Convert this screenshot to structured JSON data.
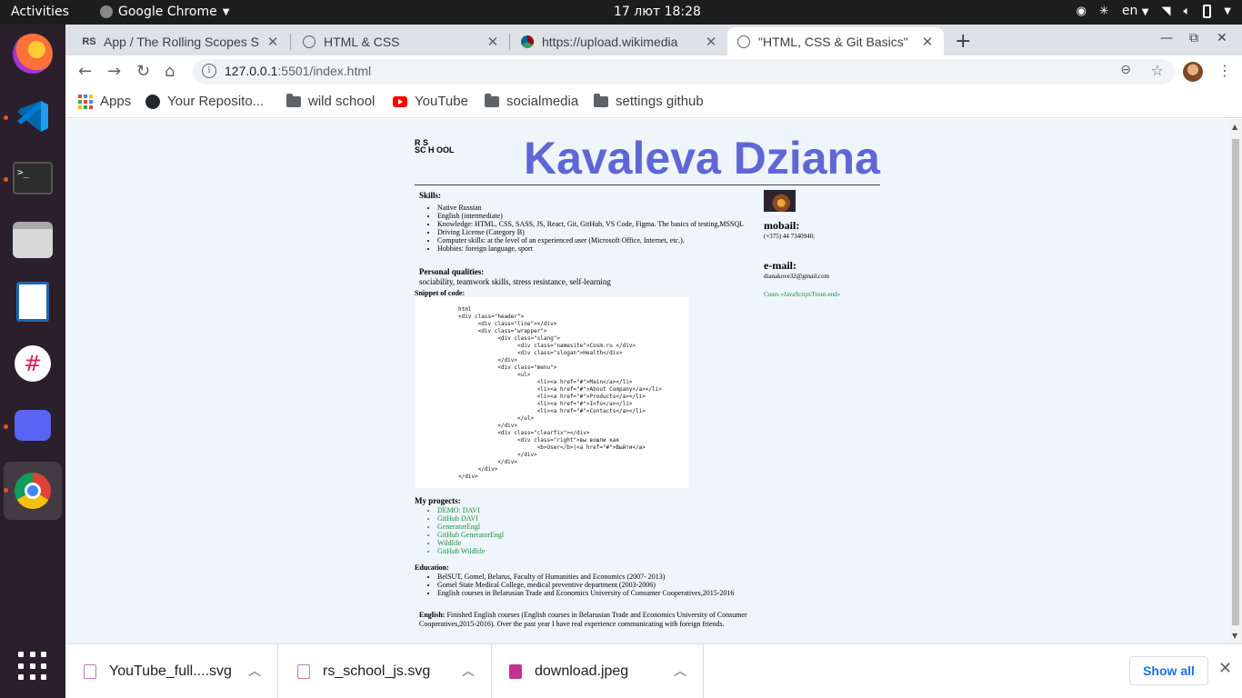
{
  "topbar": {
    "activities": "Activities",
    "app_name": "Google Chrome",
    "clock": "17 лют  18:28",
    "lang": "en"
  },
  "tabs": [
    {
      "favicon": "RS",
      "title": "App / The Rolling Scopes S",
      "active": false
    },
    {
      "favicon": "globe-icon",
      "title": "HTML & CSS",
      "active": false
    },
    {
      "favicon": "wikimedia-icon",
      "title": "https://upload.wikimedia",
      "active": false
    },
    {
      "favicon": "globe-icon",
      "title": "\"HTML, CSS & Git Basics\"",
      "active": true
    }
  ],
  "address_bar": {
    "url_host": "127.0.0.1",
    "url_rest": ":5501/index.html"
  },
  "bookmarks": [
    {
      "label": "Apps",
      "icon": "apps-grid-icon"
    },
    {
      "label": "Your Reposito...",
      "icon": "github-icon"
    },
    {
      "label": "wild school",
      "icon": "folder-icon"
    },
    {
      "label": "YouTube",
      "icon": "youtube-icon"
    },
    {
      "label": "socialmedia",
      "icon": "folder-icon"
    },
    {
      "label": "settings github",
      "icon": "folder-icon"
    }
  ],
  "page": {
    "logo_line1": "R   S",
    "logo_line2": "SC H OOL",
    "name": "Kavaleva Dziana",
    "skills_title": "Skills:",
    "skills": [
      "Native Russian",
      "English (intermediate)",
      "Knowledge: HTML, CSS, SASS, JS, React, Git, GitHub, VS Code, Figma. The basics of testing,MSSQL",
      "Driving License (Category B)",
      "Computer skills: at the level of an experienced user (Microsoft Office, Internet, etc.).",
      "Hobbies: foreign language, sport"
    ],
    "personal_title": "Personal qualities:",
    "personal_text": "sociability, teamwork skills, stress resistance, self-learning",
    "snippet_title": "Snippet of code:",
    "snippet_code": "html\n<div class=\"header\">\n      <div class=\"line\"></div>\n      <div class=\"wrapper\">\n            <div class=\"slang\">\n                  <div class=\"namesite\">Cosm.ru </div>\n                  <div class=\"slogan\">Health</div>\n            </div>\n            <div class=\"menu\">\n                  <ul>\n                        <li><a href=\"#\">Main</a></li>\n                        <li><a href=\"#\">About Company</a></li>\n                        <li><a href=\"#\">Products</a></li>\n                        <li><a href=\"#\">Info</a></li>\n                        <li><a href=\"#\">Contacts</a></li>\n                  </ul>\n            </div>\n            <div class=\"clearfix\"></div>\n                  <div class=\"right\">вы вошли как\n                        <b>User</b>|<a href=\"#\">Выйти</a>\n                  </div>\n            </div>\n      </div>\n</div>",
    "projects_title": "My progects:",
    "projects": [
      "DEMO: DAVI",
      "GitHub DAVI",
      "GeneratorEngl",
      "GitHub GeneratorEngl",
      "Wildlife",
      "GitHub Wildlife"
    ],
    "education_title": "Education:",
    "education": [
      "BelSUT, Gomel, Belarus, Faculty of Humanities and Economics (2007- 2013)",
      "Gomel State Medical College, medical preventive department (2003-2006)",
      "English courses in Belarusian Trade and Economics University of Consumer Cooperatives,2015-2016"
    ],
    "english_label": "English:",
    "english_text": " Finished English courses (English courses in Belarusian Trade and Economics University of Consumer Cooperatives,2015-2016). Over the past year I have real experience communicating with foreign friends.",
    "mobail_title": "mobail:",
    "mobail_value": "(+375) 44 7340940;",
    "email_title": "e-mail:",
    "email_value": "dianakove32@gmail.com",
    "cours_link": "Cours «JavaScript/Front-end»",
    "accent_color": "#5f67d6",
    "link_color": "#1a8f3a"
  },
  "downloads": {
    "items": [
      {
        "name": "YouTube_full....svg",
        "type": "svg"
      },
      {
        "name": "rs_school_js.svg",
        "type": "svg"
      },
      {
        "name": "download.jpeg",
        "type": "image"
      }
    ],
    "show_all": "Show all"
  }
}
